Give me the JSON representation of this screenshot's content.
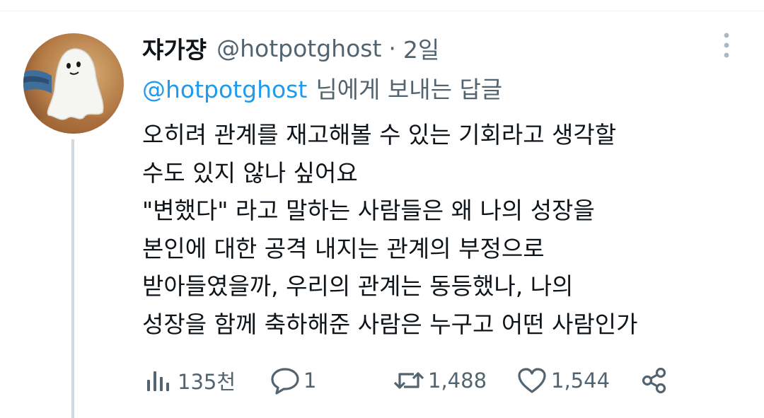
{
  "tweet": {
    "display_name": "쟈가쟝",
    "handle": "@hotpotghost",
    "separator": "·",
    "time": "2일",
    "reply_to": {
      "mention": "@hotpotghost",
      "suffix": "님에게 보내는 답글"
    },
    "body_lines": [
      "오히려 관계를 재고해볼 수 있는 기회라고 생각할",
      "수도 있지 않나 싶어요",
      "\"변했다\" 라고 말하는 사람들은 왜 나의 성장을",
      "본인에 대한 공격 내지는 관계의 부정으로",
      "받아들였을까, 우리의 관계는 동등했나, 나의",
      "성장을 함께 축하해준 사람은 누구고 어떤 사람인가"
    ],
    "stats": {
      "views": "135천",
      "replies": "1",
      "retweets": "1,488",
      "likes": "1,544"
    }
  },
  "icons": {
    "more": "more-vertical-icon",
    "views": "bar-chart-icon",
    "reply": "speech-bubble-icon",
    "retweet": "retweet-icon",
    "like": "heart-icon",
    "share": "share-icon"
  },
  "colors": {
    "link": "#1d9bf0",
    "secondary_text": "#536471",
    "primary_text": "#0f1419",
    "thread_line": "#cfd9de"
  }
}
